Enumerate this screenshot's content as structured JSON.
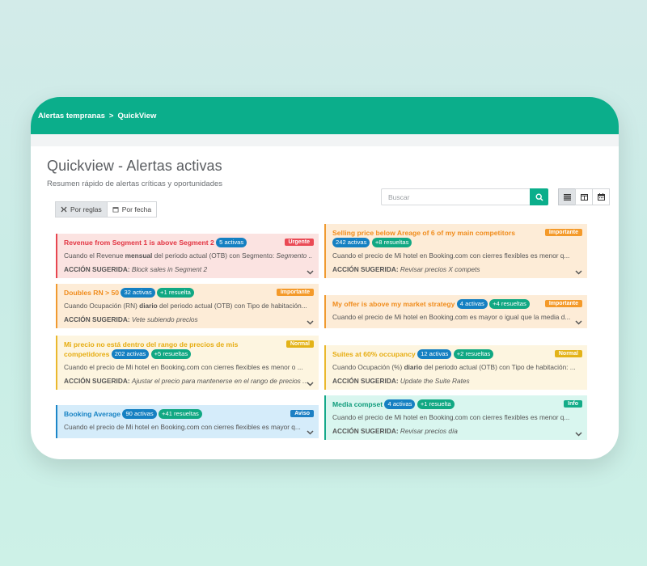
{
  "breadcrumb": {
    "parent": "Alertas tempranas",
    "separator": ">",
    "current": "QuickView"
  },
  "header": {
    "title": "Quickview - Alertas activas",
    "subtitle": "Resumen rápido de alertas críticas y oportunidades"
  },
  "search": {
    "placeholder": "Buscar"
  },
  "sort": {
    "by_rules": "Por reglas",
    "by_date": "Por fecha"
  },
  "colors": {
    "brand": "#0bae8b",
    "urgent": "#ea4a55",
    "important": "#f49a2a",
    "normal": "#e3b318",
    "warning": "#1d80c4",
    "info": "#14ac88"
  },
  "cards": [
    {
      "title": "Revenue from Segment 1 is above Segment 2",
      "active": "5 activas",
      "resolved": "",
      "status": "Urgente",
      "desc_pre": "Cuando el Revenue ",
      "desc_bold": "mensual",
      "desc_post": " del periodo actual (OTB) con Segmento: ",
      "desc_italic": "Segmento ...",
      "action_label": "ACCIÓN SUGERIDA:",
      "action_text": "Block sales in Segment 2"
    },
    {
      "title": "Selling price below Areage of 6 of my main competitors",
      "active": "242 activas",
      "resolved": "+8 resueltas",
      "status": "Importante",
      "desc": "Cuando el precio de Mi hotel en Booking.com con cierres flexibles es menor q...",
      "action_label": "ACCIÓN SUGERIDA:",
      "action_text": "Revisar precios X compets"
    },
    {
      "title": "Doubles RN > 50",
      "active": "32 activas",
      "resolved": "+1 resuelta",
      "status": "Importante",
      "desc_pre": "Cuando Ocupación (RN) ",
      "desc_bold": "diario",
      "desc_post": " del periodo actual (OTB) con Tipo de habitación...",
      "action_label": "ACCIÓN SUGERIDA:",
      "action_text": "Vete subiendo precios"
    },
    {
      "title": "My offer is above my market strategy",
      "active": "4 activas",
      "resolved": "+4 resueltas",
      "status": "Importante",
      "desc": "Cuando el precio de Mi hotel en Booking.com es mayor o igual que la media d..."
    },
    {
      "title": "Mi precio no está dentro del rango de precios de mis competidores",
      "title_line1": "Mi precio no está dentro del rango de precios de mis",
      "title_line2": "competidores",
      "active": "202 activas",
      "resolved": "+5 resueltas",
      "status": "Normal",
      "desc": "Cuando el precio de Mi hotel en Booking.com con cierres flexibles es menor o ...",
      "action_label": "ACCIÓN SUGERIDA:",
      "action_text": "Ajustar el precio para mantenerse en el rango de precios ..."
    },
    {
      "title": "Suites at 60% occupancy",
      "active": "12 activas",
      "resolved": "+2 resueltas",
      "status": "Normal",
      "desc_pre": "Cuando Ocupación (%) ",
      "desc_bold": "diario",
      "desc_post": " del periodo actual (OTB) con Tipo de habitación: ...",
      "action_label": "ACCIÓN SUGERIDA:",
      "action_text": "Update the Suite Rates"
    },
    {
      "title": "Booking Average",
      "active": "90 activas",
      "resolved": "+41 resueltas",
      "status": "Aviso",
      "desc": "Cuando el precio de Mi hotel en Booking.com con cierres flexibles es mayor q..."
    },
    {
      "title": "Media compset",
      "active": "4 activas",
      "resolved": "+1 resuelta",
      "status": "Info",
      "desc": "Cuando el precio de Mi hotel en Booking.com con cierres flexibles es menor q...",
      "action_label": "ACCIÓN SUGERIDA:",
      "action_text": "Revisar precios día"
    }
  ]
}
